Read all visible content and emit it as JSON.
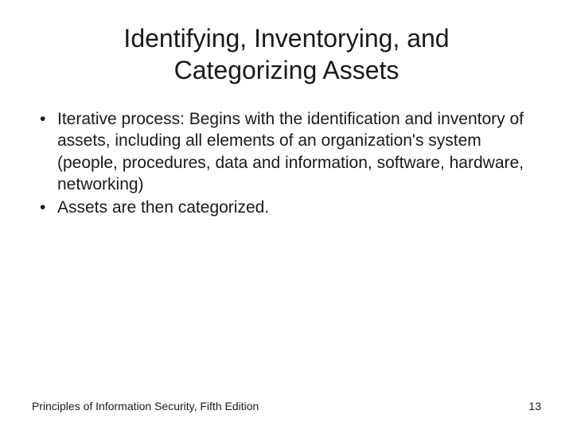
{
  "title": "Identifying, Inventorying, and Categorizing Assets",
  "bullets": [
    "Iterative process: Begins with the identification and inventory of assets, including all elements of an organization's system (people, procedures, data and information, software, hardware, networking)",
    "Assets are then categorized."
  ],
  "footer": {
    "source": "Principles of Information Security, Fifth Edition",
    "page": "13"
  }
}
